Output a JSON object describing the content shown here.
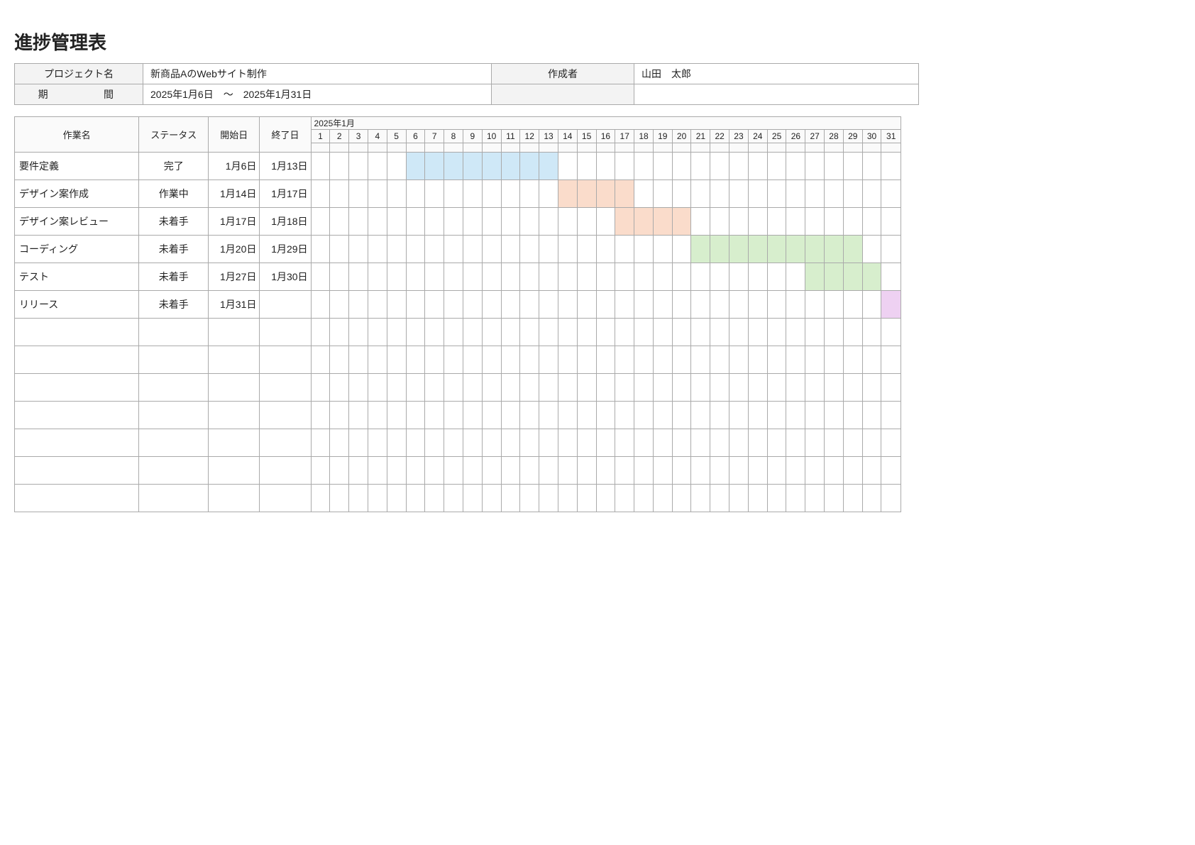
{
  "title": "進捗管理表",
  "info": {
    "project_label": "プロジェクト名",
    "project_value": "新商品AのWebサイト制作",
    "author_label": "作成者",
    "author_value": "山田　太郎",
    "period_label": "期　　間",
    "period_value": "2025年1月6日　～　2025年1月31日"
  },
  "headers": {
    "task": "作業名",
    "status": "ステータス",
    "start": "開始日",
    "end": "終了日",
    "month": "2025年1月"
  },
  "days": [
    "1",
    "2",
    "3",
    "4",
    "5",
    "6",
    "7",
    "8",
    "9",
    "10",
    "11",
    "12",
    "13",
    "14",
    "15",
    "16",
    "17",
    "18",
    "19",
    "20",
    "21",
    "22",
    "23",
    "24",
    "25",
    "26",
    "27",
    "28",
    "29",
    "30",
    "31"
  ],
  "colors": {
    "blue": "#cfe8f7",
    "orange": "#fadccb",
    "green": "#d7eecd",
    "purple": "#eed1f2"
  },
  "tasks": [
    {
      "name": "要件定義",
      "status": "完了",
      "start": "1月6日",
      "end": "1月13日",
      "bar_start": 6,
      "bar_end": 13,
      "color": "blue"
    },
    {
      "name": "デザイン案作成",
      "status": "作業中",
      "start": "1月14日",
      "end": "1月17日",
      "bar_start": 14,
      "bar_end": 17,
      "color": "orange"
    },
    {
      "name": "デザイン案レビュー",
      "status": "未着手",
      "start": "1月17日",
      "end": "1月18日",
      "bar_start": 17,
      "bar_end": 20,
      "color": "orange"
    },
    {
      "name": "コーディング",
      "status": "未着手",
      "start": "1月20日",
      "end": "1月29日",
      "bar_start": 21,
      "bar_end": 29,
      "color": "green"
    },
    {
      "name": "テスト",
      "status": "未着手",
      "start": "1月27日",
      "end": "1月30日",
      "bar_start": 27,
      "bar_end": 30,
      "color": "green"
    },
    {
      "name": "リリース",
      "status": "未着手",
      "start": "1月31日",
      "end": "",
      "bar_start": 31,
      "bar_end": 31,
      "color": "purple"
    }
  ],
  "empty_rows": 7,
  "chart_data": {
    "type": "gantt",
    "title": "進捗管理表",
    "x_axis": {
      "unit": "day",
      "start": "2025-01-01",
      "end": "2025-01-31"
    },
    "series": [
      {
        "name": "要件定義",
        "start": 6,
        "end": 13,
        "status": "完了"
      },
      {
        "name": "デザイン案作成",
        "start": 14,
        "end": 17,
        "status": "作業中"
      },
      {
        "name": "デザイン案レビュー",
        "start": 17,
        "end": 20,
        "status": "未着手"
      },
      {
        "name": "コーディング",
        "start": 21,
        "end": 29,
        "status": "未着手"
      },
      {
        "name": "テスト",
        "start": 27,
        "end": 30,
        "status": "未着手"
      },
      {
        "name": "リリース",
        "start": 31,
        "end": 31,
        "status": "未着手"
      }
    ]
  }
}
